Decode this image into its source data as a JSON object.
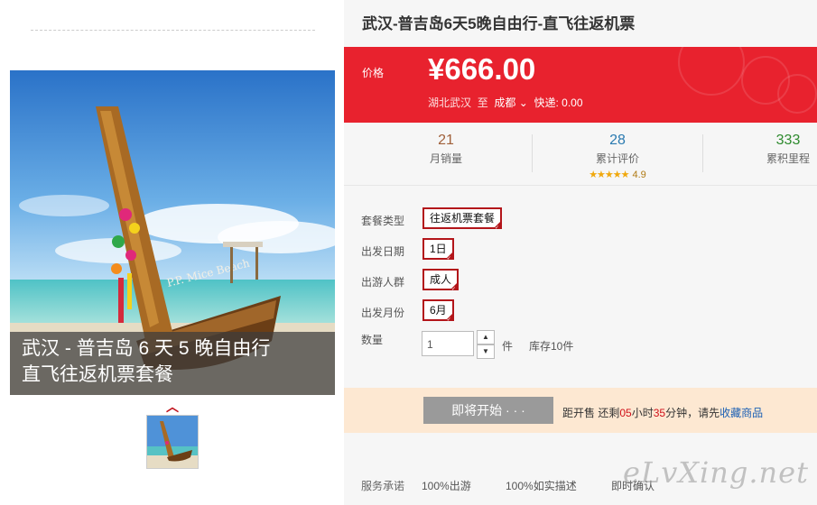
{
  "product": {
    "title": "武汉-普吉岛6天5晚自由行-直飞往返机票",
    "image_caption_line1": "武汉 - 普吉岛 6 天 5 晚自由行",
    "image_caption_line2": "直飞往返机票套餐"
  },
  "price": {
    "label": "价格",
    "value": "¥666.00",
    "origin": "湖北武汉",
    "to": "至",
    "destination": "成都",
    "shipping_label": "快递:",
    "shipping_value": "0.00"
  },
  "stats": {
    "monthly_sales": {
      "value": "21",
      "label": "月销量",
      "color": "#a0603a"
    },
    "reviews": {
      "value": "28",
      "label": "累计评价",
      "color": "#2a7ab0",
      "stars": "★★★★★",
      "score": "4.9"
    },
    "mileage": {
      "value": "333",
      "label": "累积里程",
      "color": "#2e8a2e"
    }
  },
  "options": {
    "package_type": {
      "label": "套餐类型",
      "value": "往返机票套餐"
    },
    "departure_date": {
      "label": "出发日期",
      "value": "1日"
    },
    "traveler": {
      "label": "出游人群",
      "value": "成人"
    },
    "departure_month": {
      "label": "出发月份",
      "value": "6月"
    }
  },
  "quantity": {
    "label": "数量",
    "value": "1",
    "unit": "件",
    "stock": "库存10件"
  },
  "promo": {
    "button": "即将开始 · · ·",
    "cd_prefix": "距开售 还剩",
    "hours": "05",
    "hours_unit": "小时",
    "minutes": "35",
    "minutes_unit": "分钟，请先",
    "favorite": "收藏商品"
  },
  "service": {
    "label": "服务承诺",
    "items": [
      "100%出游",
      "100%如实描述",
      "即时确认"
    ]
  },
  "watermark": "eLvXing.net",
  "colors": {
    "accent": "#e8222e",
    "option_border": "#b3151a",
    "promo_bg": "#fde8d2"
  }
}
